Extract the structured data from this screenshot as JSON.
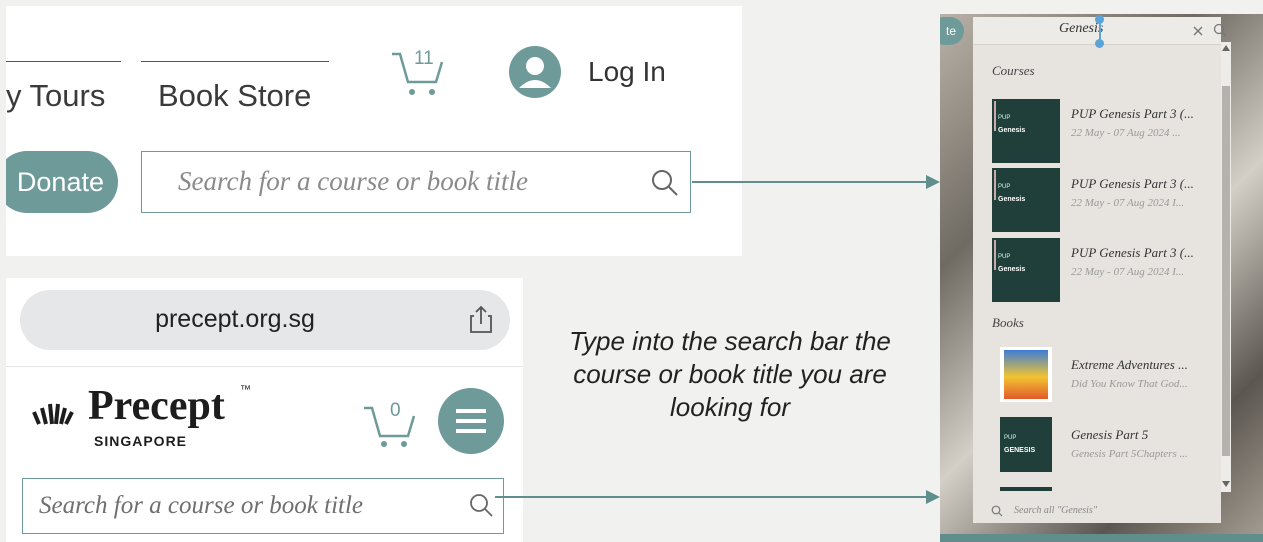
{
  "desktop": {
    "nav_tours": "y Tours",
    "nav_bookstore": "Book Store",
    "cart_count": "11",
    "login_label": "Log In",
    "donate_label": "Donate",
    "search_placeholder": "Search for a course or book title"
  },
  "mobile": {
    "url": "precept.org.sg",
    "logo_name": "Precept",
    "logo_tm": "™",
    "logo_sub": "SINGAPORE",
    "cart_count": "0",
    "search_placeholder": "Search for a course or book title"
  },
  "caption": "Type into the search bar the course or book title you are looking for",
  "dropdown": {
    "donate_fragment": "te",
    "query": "Genesis",
    "sections": {
      "courses": "Courses",
      "books": "Books"
    },
    "courses": [
      {
        "title": "PUP Genesis Part 3 (...",
        "subtitle": "22 May - 07 Aug 2024 ..."
      },
      {
        "title": "PUP Genesis Part 3 (...",
        "subtitle": "22 May - 07 Aug 2024 I..."
      },
      {
        "title": "PUP Genesis Part 3 (...",
        "subtitle": "22 May - 07 Aug 2024 I..."
      }
    ],
    "books": [
      {
        "title": "Extreme Adventures ...",
        "subtitle": "Did You Know That God..."
      },
      {
        "title": "Genesis Part 5",
        "subtitle": "Genesis Part 5Chapters ..."
      }
    ],
    "thumb_text": {
      "pup": "PUP",
      "genesis": "Genesis",
      "genesis_caps": "GENESIS"
    },
    "footer": "Search all \"Genesis\""
  },
  "colors": {
    "accent": "#6e9a99",
    "dropdown_bg": "#e7e4df",
    "thumb": "#213f3a"
  }
}
